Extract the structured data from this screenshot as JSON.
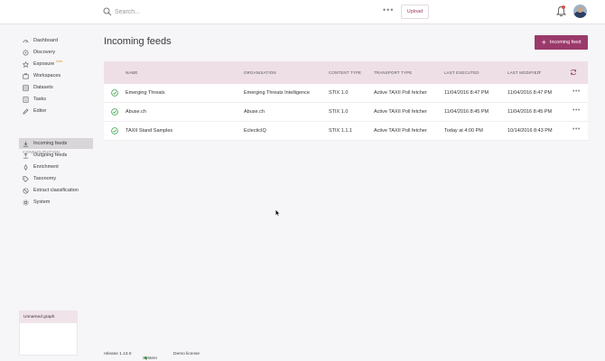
{
  "search": {
    "placeholder": "Search..."
  },
  "topbar": {
    "more": "•••",
    "upload_label": "Upload"
  },
  "sidebar": {
    "items": [
      {
        "label": "Dashboard",
        "icon": "dashboard-icon"
      },
      {
        "label": "Discovery",
        "icon": "discovery-icon"
      },
      {
        "label": "Exposure",
        "icon": "star-icon",
        "badge": "beta"
      },
      {
        "label": "Workspaces",
        "icon": "workspaces-icon"
      },
      {
        "label": "Datasets",
        "icon": "datasets-icon"
      },
      {
        "label": "Tasks",
        "icon": "tasks-icon"
      },
      {
        "label": "Editor",
        "icon": "editor-icon"
      }
    ],
    "config_label": "CONFIGURATION",
    "config_items": [
      {
        "label": "Incoming feeds",
        "icon": "download-icon",
        "active": true
      },
      {
        "label": "Outgoing feeds",
        "icon": "upload-icon"
      },
      {
        "label": "Enrichment",
        "icon": "enrichment-icon"
      },
      {
        "label": "Taxonomy",
        "icon": "tag-icon"
      },
      {
        "label": "Extract classification",
        "icon": "block-icon"
      },
      {
        "label": "System",
        "icon": "gear-icon"
      }
    ]
  },
  "graph_panel": {
    "title": "Unnamed graph"
  },
  "main": {
    "title": "Incoming feeds",
    "add_button": {
      "icon": "+",
      "label": "Incoming feed"
    },
    "table": {
      "columns": [
        "NAME",
        "ORGANISATION",
        "CONTENT TYPE",
        "TRANSPORT TYPE",
        "LAST EXECUTED",
        "LAST MODIFIED"
      ],
      "sort_indicator": "^",
      "rows": [
        {
          "name": "Emerging Threats",
          "organisation": "Emerging Threats Intelligence",
          "content_type": "STIX 1.0",
          "transport_type": "Active TAXII Poll fetcher",
          "last_executed": "11/04/2016 8:47 PM",
          "last_modified": "11/04/2016 8:47 PM",
          "more": "•••"
        },
        {
          "name": "Abuse.ch",
          "organisation": "Abuse.ch",
          "content_type": "STIX 1.0",
          "transport_type": "Active TAXII Poll fetcher",
          "last_executed": "11/04/2016 8:45 PM",
          "last_modified": "11/04/2016 8:45 PM",
          "more": "•••"
        },
        {
          "name": "TAXII Stand Samples",
          "organisation": "EclecticIQ",
          "content_type": "STIX 1.1.1",
          "transport_type": "Active TAXII Poll fetcher",
          "last_executed": "Today at 4:00 PM",
          "last_modified": "10/14/2016 8:43 PM",
          "more": "•••"
        }
      ]
    }
  },
  "footer": {
    "release": "release 1.13.0",
    "system": "System",
    "license": "Demo license"
  },
  "colors": {
    "accent": "#9b3a6a",
    "header_row": "#eedfe6",
    "ok_green": "#3aa04a"
  }
}
